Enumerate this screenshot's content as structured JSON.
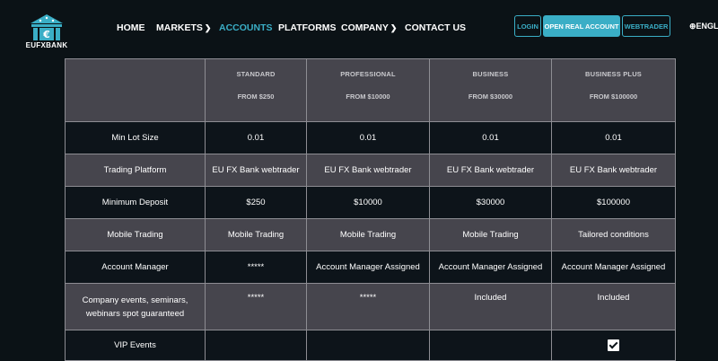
{
  "brand": {
    "name": "EUFXBANK",
    "accent": "#3aaec6"
  },
  "nav": [
    {
      "label": "HOME",
      "dropdown": false,
      "active": false
    },
    {
      "label": "MARKETS",
      "dropdown": true,
      "active": false
    },
    {
      "label": "ACCOUNTS",
      "dropdown": false,
      "active": true
    },
    {
      "label": "PLATFORMS",
      "dropdown": false,
      "active": false
    },
    {
      "label": "COMPANY",
      "dropdown": true,
      "active": false
    },
    {
      "label": "CONTACT US",
      "dropdown": false,
      "active": false
    }
  ],
  "buttons": {
    "login": "LOGIN",
    "open": "OPEN REAL ACCOUNT",
    "webtrader": "WEBTRADER"
  },
  "language": "ENGL",
  "plans": [
    {
      "name": "STANDARD",
      "from": "FROM $250"
    },
    {
      "name": "PROFESSIONAL",
      "from": "FROM $10000"
    },
    {
      "name": "BUSINESS",
      "from": "FROM $30000"
    },
    {
      "name": "BUSINESS PLUS",
      "from": "FROM $100000"
    }
  ],
  "rows": [
    {
      "label": "Min Lot Size",
      "values": [
        "0.01",
        "0.01",
        "0.01",
        "0.01"
      ]
    },
    {
      "label": "Trading Platform",
      "values": [
        "EU FX Bank webtrader",
        "EU FX Bank webtrader",
        "EU FX Bank webtrader",
        "EU FX Bank webtrader"
      ]
    },
    {
      "label": "Minimum Deposit",
      "values": [
        "$250",
        "$10000",
        "$30000",
        "$100000"
      ]
    },
    {
      "label": "Mobile Trading",
      "values": [
        "Mobile Trading",
        "Mobile Trading",
        "Mobile Trading",
        "Tailored conditions"
      ]
    },
    {
      "label": "Account Manager",
      "values": [
        "*****",
        "Account Manager Assigned",
        "Account Manager Assigned",
        "Account Manager Assigned"
      ]
    },
    {
      "label": "Company events, seminars, webinars spot guaranteed",
      "values": [
        "*****",
        "*****",
        "Included",
        "Included"
      ]
    },
    {
      "label": "VIP Events",
      "values": [
        "",
        "",
        "",
        ""
      ],
      "checked": [
        false,
        false,
        false,
        true
      ]
    }
  ]
}
